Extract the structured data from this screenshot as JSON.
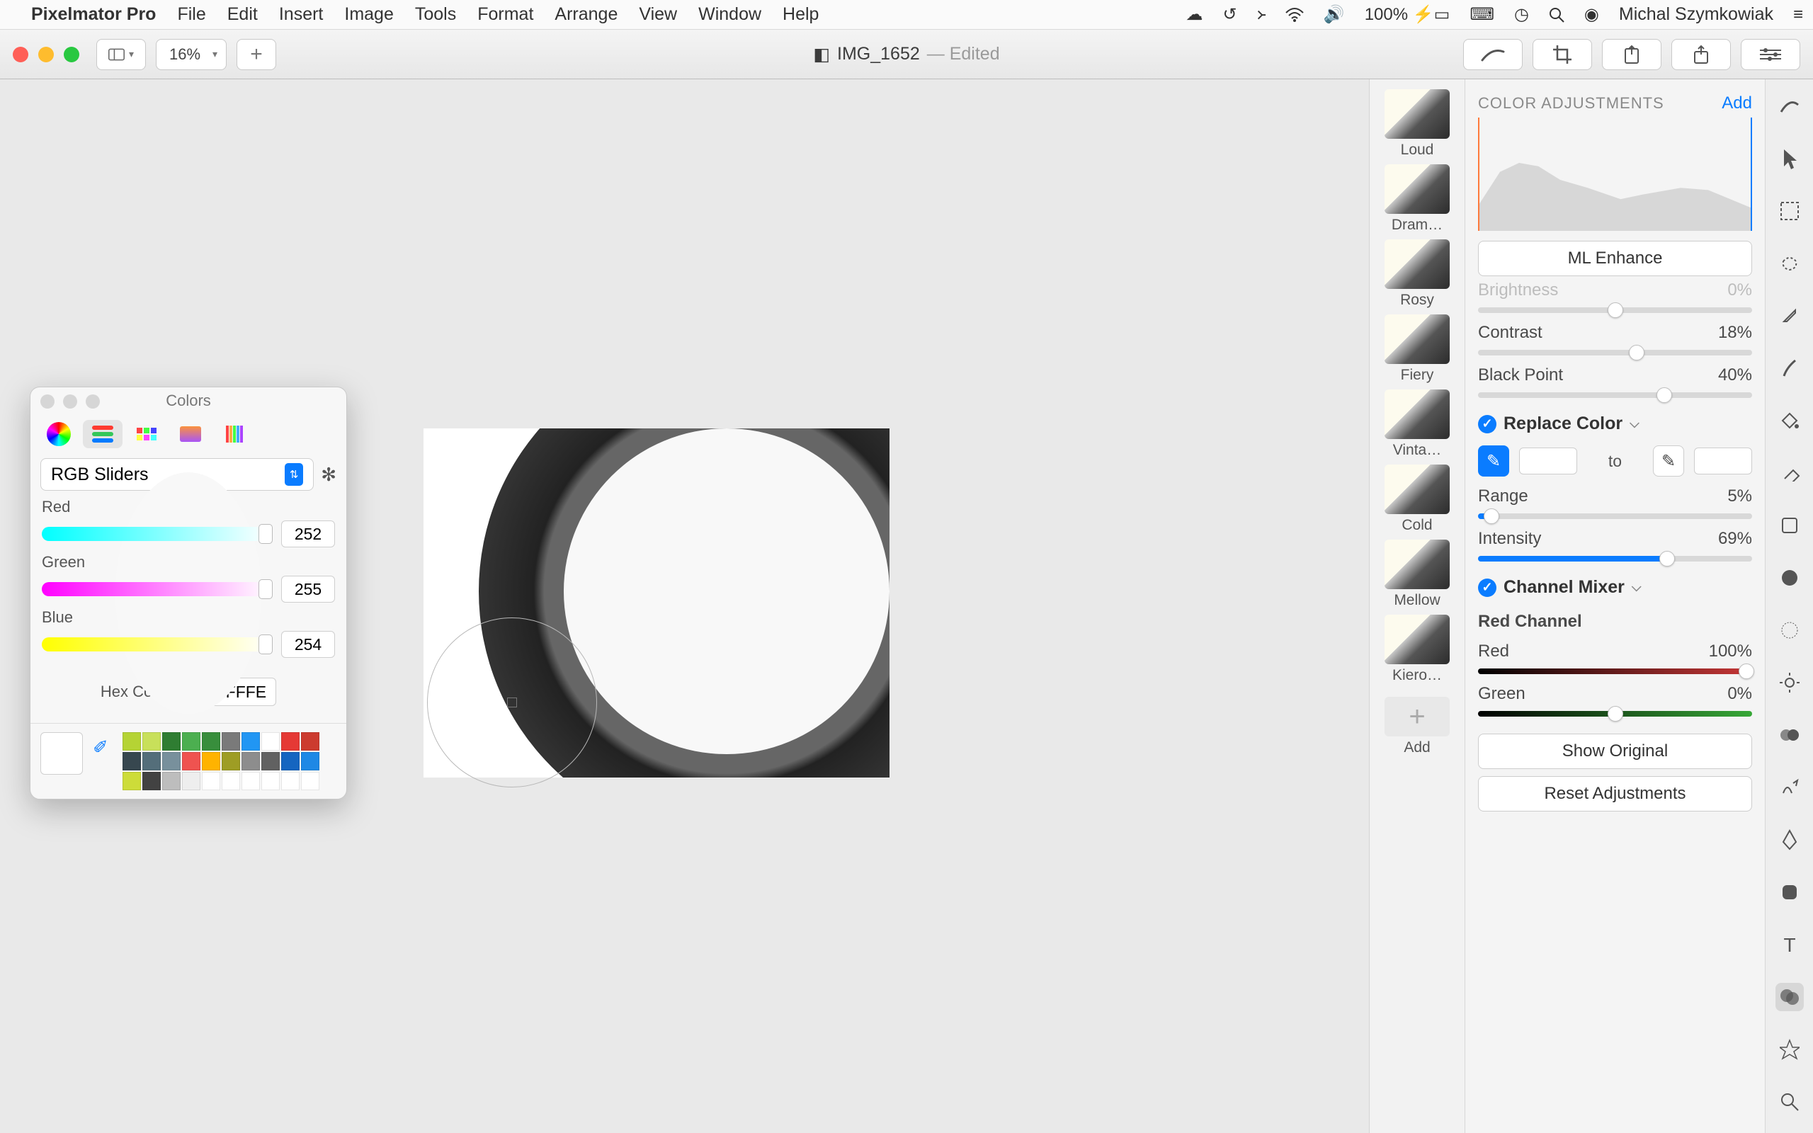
{
  "menubar": {
    "app": "Pixelmator Pro",
    "items": [
      "File",
      "Edit",
      "Insert",
      "Image",
      "Tools",
      "Format",
      "Arrange",
      "View",
      "Window",
      "Help"
    ],
    "battery": "100%",
    "user": "Michal Szymkowiak"
  },
  "toolbar": {
    "zoom": "16%",
    "doc": "IMG_1652",
    "edited": "— Edited"
  },
  "layers": [
    {
      "label": "Loud"
    },
    {
      "label": "Dram…"
    },
    {
      "label": "Rosy"
    },
    {
      "label": "Fiery"
    },
    {
      "label": "Vinta…"
    },
    {
      "label": "Cold"
    },
    {
      "label": "Mellow"
    },
    {
      "label": "Kiero…"
    }
  ],
  "layers_add": "Add",
  "panel": {
    "title": "COLOR ADJUSTMENTS",
    "add": "Add",
    "ml": "ML Enhance",
    "brightness_label": "Brightness",
    "brightness_val": "0%",
    "contrast_label": "Contrast",
    "contrast_val": "18%",
    "bp_label": "Black Point",
    "bp_val": "40%",
    "replace_title": "Replace Color",
    "to": "to",
    "range_label": "Range",
    "range_val": "5%",
    "intensity_label": "Intensity",
    "intensity_val": "69%",
    "mixer_title": "Channel Mixer",
    "mixer_sub": "Red Channel",
    "mix_red_label": "Red",
    "mix_red_val": "100%",
    "mix_green_label": "Green",
    "mix_green_val": "0%",
    "show_original": "Show Original",
    "reset": "Reset Adjustments"
  },
  "colors": {
    "title": "Colors",
    "mode": "RGB Sliders",
    "red_label": "Red",
    "red_val": "252",
    "green_label": "Green",
    "green_val": "255",
    "blue_label": "Blue",
    "blue_val": "254",
    "hex_label": "Hex Color #",
    "hex_val": "FCFFFE",
    "swatches": [
      "#b5d334",
      "#c8e05a",
      "#2f7d32",
      "#4caf50",
      "#388e3c",
      "#7a7a7a",
      "#2196f3",
      "#ffffff",
      "#e53935",
      "#cc3b2f",
      "#37474f",
      "#546e7a",
      "#78909c",
      "#ef5350",
      "#ffb300",
      "#9e9d24",
      "#8d8d8d",
      "#616161",
      "#1565c0",
      "#1e88e5",
      "#cddc39",
      "#424242",
      "#bdbdbd",
      "#eeeeee",
      "#ffffff",
      "#ffffff",
      "#ffffff",
      "#ffffff",
      "#ffffff",
      "#ffffff"
    ]
  }
}
